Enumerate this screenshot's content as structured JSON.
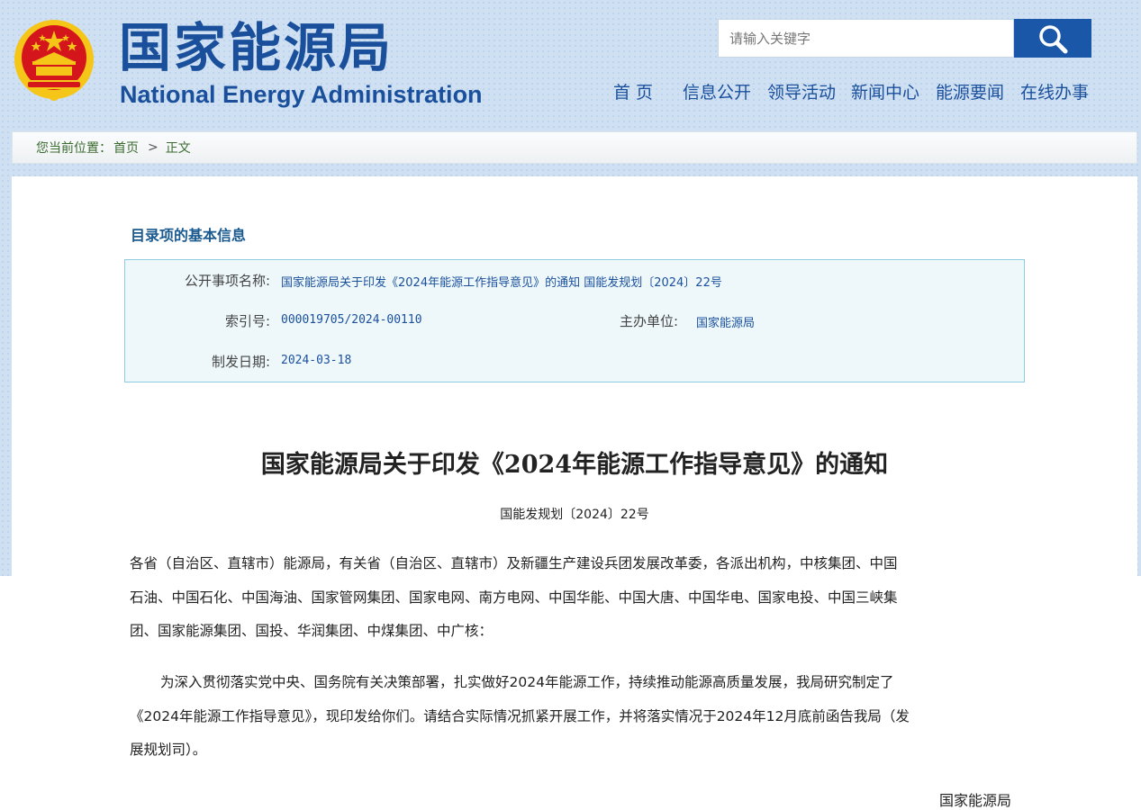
{
  "header": {
    "logo_cn": "国家能源局",
    "logo_en": "National Energy Administration",
    "search_placeholder": "请输入关键字",
    "nav": [
      "首 页",
      "信息公开",
      "领导活动",
      "新闻中心",
      "能源要闻",
      "在线办事"
    ]
  },
  "breadcrumb": {
    "prefix": "您当前位置：",
    "home": "首页",
    "separator": ">",
    "current": "正文"
  },
  "info": {
    "section_title": "目录项的基本信息",
    "name_label": "公开事项名称:",
    "name_value": "国家能源局关于印发《2024年能源工作指导意见》的通知 国能发规划〔2024〕22号",
    "index_label": "索引号:",
    "index_value": "000019705/2024-00110",
    "host_label": "主办单位:",
    "host_value": "国家能源局",
    "date_label": "制发日期:",
    "date_value": "2024-03-18"
  },
  "document": {
    "title": "国家能源局关于印发《2024年能源工作指导意见》的通知",
    "number": "国能发规划〔2024〕22号",
    "addressees_lines": [
      "各省（自治区、直辖市）能源局，有关省（自治区、直辖市）及新疆生产建设兵团发展改革委，各派出机构，中核集团、中国",
      "石油、中国石化、中国海油、国家管网集团、国家电网、南方电网、中国华能、中国大唐、中国华电、国家电投、中国三峡集",
      "团、国家能源集团、国投、华润集团、中煤集团、中广核："
    ],
    "body_lines": [
      "为深入贯彻落实党中央、国务院有关决策部署，扎实做好2024年能源工作，持续推动能源高质量发展，我局研究制定了",
      "《2024年能源工作指导意见》，现印发给你们。请结合实际情况抓紧开展工作，并将落实情况于2024年12月底前函告我局（发",
      "展规划司）。"
    ],
    "signature": "国家能源局"
  },
  "colors": {
    "brand_blue": "#1a4f9c",
    "search_button": "#1a57a8",
    "emblem_red": "#d4161c",
    "emblem_gold": "#f5c518",
    "info_bg": "#eef8fb",
    "info_border": "#8fcbe0",
    "breadcrumb_text": "#3b6b2f"
  },
  "icons": {
    "search": "magnifier-icon",
    "emblem": "national-emblem-icon"
  }
}
